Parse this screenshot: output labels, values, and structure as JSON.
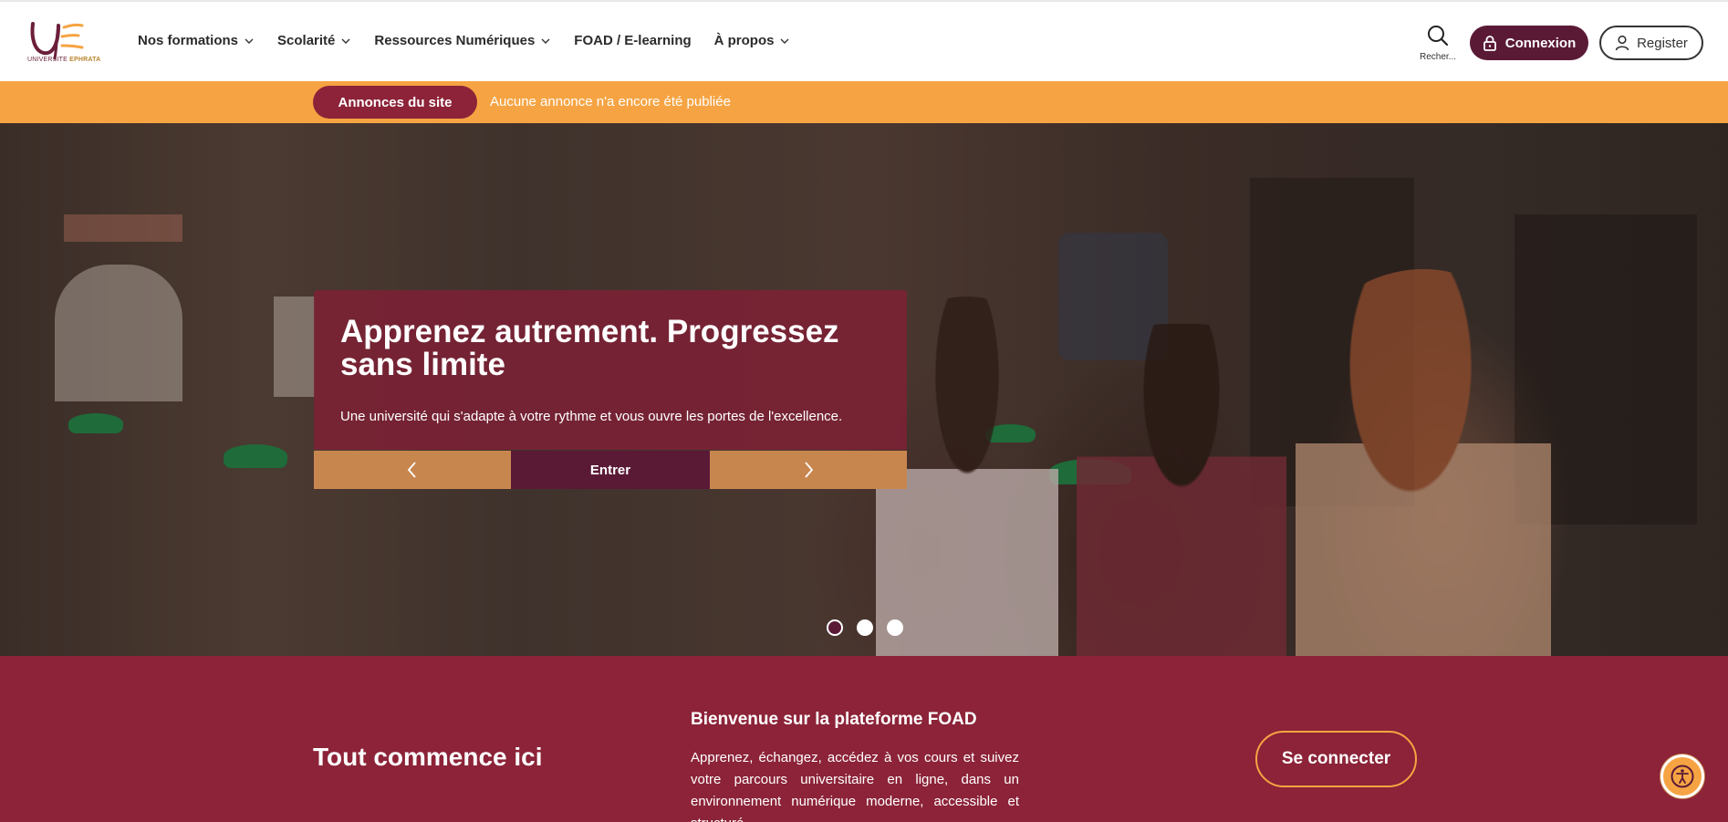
{
  "brand": {
    "logo_text_1": "UNIVERSITE",
    "logo_text_2": "EPHRATA",
    "colors": {
      "primary": "#5a1a36",
      "secondary": "#8c2338",
      "accent": "#f6a443",
      "tan": "#c8864f"
    }
  },
  "nav": {
    "items": [
      {
        "label": "Nos formations",
        "has_dropdown": true
      },
      {
        "label": "Scolarité",
        "has_dropdown": true
      },
      {
        "label": "Ressources Numériques",
        "has_dropdown": true
      },
      {
        "label": "FOAD / E-learning",
        "has_dropdown": false
      },
      {
        "label": "À propos",
        "has_dropdown": true
      }
    ],
    "search_label": "Recher...",
    "login_label": "Connexion",
    "register_label": "Register"
  },
  "announcements": {
    "badge": "Annonces du site",
    "text": "Aucune annonce n'a encore été publiée"
  },
  "hero": {
    "title": "Apprenez autrement. Progressez sans limite",
    "subtitle": "Une université qui s'adapte à votre rythme et vous ouvre les portes de l'excellence.",
    "enter_label": "Entrer",
    "slides_count": 3,
    "active_slide": 1,
    "icons": {
      "prev": "chevron-left-icon",
      "next": "chevron-right-icon"
    }
  },
  "welcome": {
    "tagline": "Tout commence ici",
    "heading": "Bienvenue sur la plateforme FOAD",
    "description": "Apprenez, échangez, accédez à vos cours et suivez votre parcours universitaire en ligne, dans un environnement numérique moderne, accessible et structuré.",
    "connect_label": "Se connecter"
  }
}
